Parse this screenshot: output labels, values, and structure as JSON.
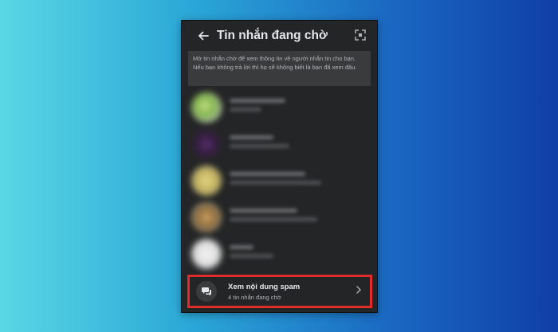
{
  "header": {
    "back_icon": "arrow-left-icon",
    "title": "Tin nhắn đang chờ",
    "expand_icon": "expand-icon"
  },
  "info_text": "Mở tin nhắn chờ để xem thông tin về người nhắn tin cho bạn. Nếu bạn không trả lời thì họ sẽ không biết là bạn đã xem đâu.",
  "conversations_note": "blurred",
  "spam": {
    "icon": "chat-bubbles-icon",
    "title": "Xem nội dung spam",
    "subtitle": "4 tin nhắn đang chờ",
    "chevron_icon": "chevron-right-icon",
    "highlight_color": "#e22b2b"
  }
}
